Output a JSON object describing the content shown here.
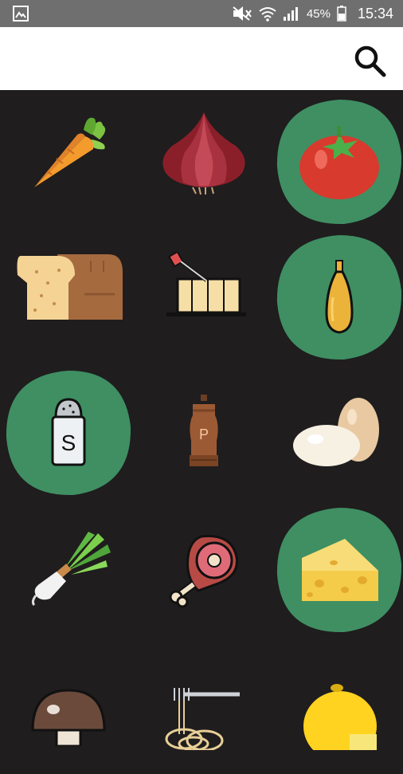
{
  "status_bar": {
    "battery_percent": "45%",
    "time": "15:34",
    "icons": [
      "image-icon",
      "mute-icon",
      "wifi-icon",
      "signal-icon",
      "battery-icon"
    ]
  },
  "app_bar": {
    "search_icon": "search-icon"
  },
  "colors": {
    "status_bar_bg": "#6f6f6f",
    "app_bar_bg": "#ffffff",
    "grid_bg": "#1f1d1e",
    "selected_bg": "#3f8f63"
  },
  "ingredients": [
    {
      "icon": "carrot-icon",
      "selected": false
    },
    {
      "icon": "onion-icon",
      "selected": false
    },
    {
      "icon": "tomato-icon",
      "selected": true
    },
    {
      "icon": "bread-icon",
      "selected": false
    },
    {
      "icon": "butter-icon",
      "selected": false
    },
    {
      "icon": "oil-bottle-icon",
      "selected": true
    },
    {
      "icon": "salt-shaker-icon",
      "selected": true
    },
    {
      "icon": "pepper-mill-icon",
      "selected": false
    },
    {
      "icon": "eggs-icon",
      "selected": false
    },
    {
      "icon": "leek-icon",
      "selected": false
    },
    {
      "icon": "ham-icon",
      "selected": false
    },
    {
      "icon": "cheese-icon",
      "selected": true
    },
    {
      "icon": "mushroom-icon",
      "selected": false
    },
    {
      "icon": "pasta-icon",
      "selected": false
    },
    {
      "icon": "lemon-icon",
      "selected": false
    }
  ],
  "salt_letter": "S",
  "pepper_letter": "P"
}
